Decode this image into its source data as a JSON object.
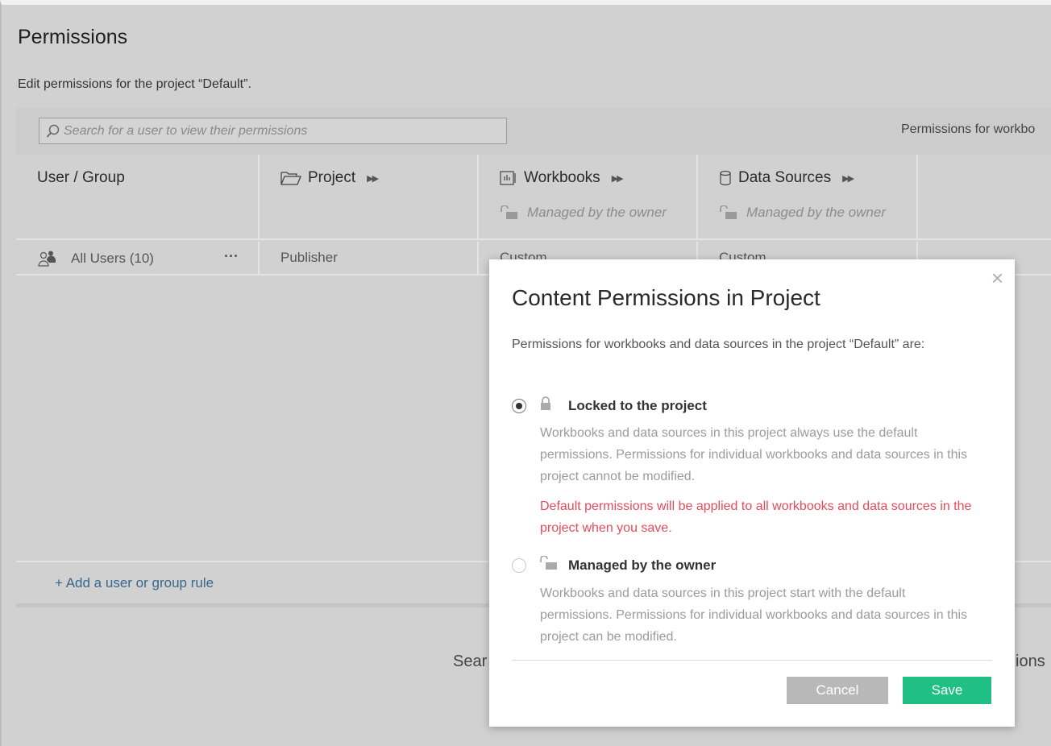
{
  "page": {
    "title": "Permissions",
    "subtitle": "Edit permissions for the project “Default”."
  },
  "toolbar": {
    "search_placeholder": "Search for a user to view their permissions",
    "right_label": "Permissions for workbo"
  },
  "columns": {
    "user_group": "User / Group",
    "project": "Project",
    "workbooks": "Workbooks",
    "data_sources": "Data Sources",
    "workbooks_status": "Managed by the owner",
    "data_sources_status": "Managed by the owner"
  },
  "row": {
    "user": "All Users (10)",
    "more": "···",
    "project": "Publisher",
    "workbooks": "Custom",
    "data_sources": "Custom"
  },
  "footer": {
    "add_rule": "+ Add a user or group rule",
    "frag_left": "Sear",
    "frag_right": "ions"
  },
  "modal": {
    "close": "×",
    "title": "Content Permissions in Project",
    "intro": "Permissions for workbooks and data sources in the project “Default” are:",
    "option_locked": {
      "label": "Locked to the project",
      "description": "Workbooks and data sources in this project always use the default permissions. Permissions for individual workbooks and data sources in this project cannot be modified.",
      "warning": "Default permissions will be applied to all workbooks and data sources in the project when you save.",
      "selected": true
    },
    "option_owner": {
      "label": "Managed by the owner",
      "description": "Workbooks and data sources in this project start with the default permissions. Permissions for individual workbooks and data sources in this project can be modified.",
      "selected": false
    },
    "cancel": "Cancel",
    "save": "Save"
  },
  "colors": {
    "save": "#1fbf86",
    "warning": "#e44c5c",
    "link": "#38678a"
  }
}
